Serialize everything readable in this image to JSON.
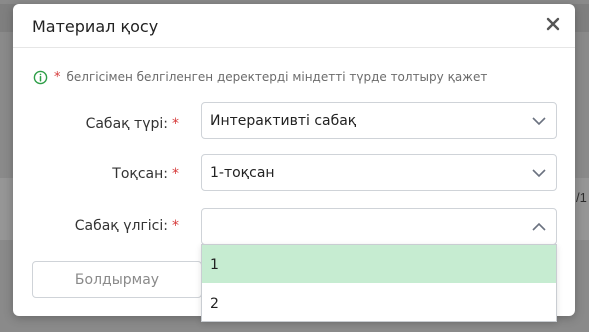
{
  "modal": {
    "title": "Материал қосу",
    "notice": {
      "star": "*",
      "text": "белгісімен белгіленген деректерді міндетті түрде толтыру қажет"
    },
    "fields": [
      {
        "label": "Сабақ түрі:",
        "required": "*",
        "value": "Интерактивті сабақ",
        "open": false
      },
      {
        "label": "Тоқсан:",
        "required": "*",
        "value": "1-тоқсан",
        "open": false
      },
      {
        "label": "Сабақ үлгісі:",
        "required": "*",
        "value": "",
        "open": true
      }
    ],
    "cancel_label": "Болдырмау"
  },
  "dropdown": {
    "options": [
      "1",
      "2"
    ],
    "highlighted_index": 0
  },
  "background": {
    "peek_text": "/1"
  },
  "colors": {
    "required": "#d63a3a",
    "info_icon": "#2e9e48",
    "highlight": "#c6ecd1"
  }
}
